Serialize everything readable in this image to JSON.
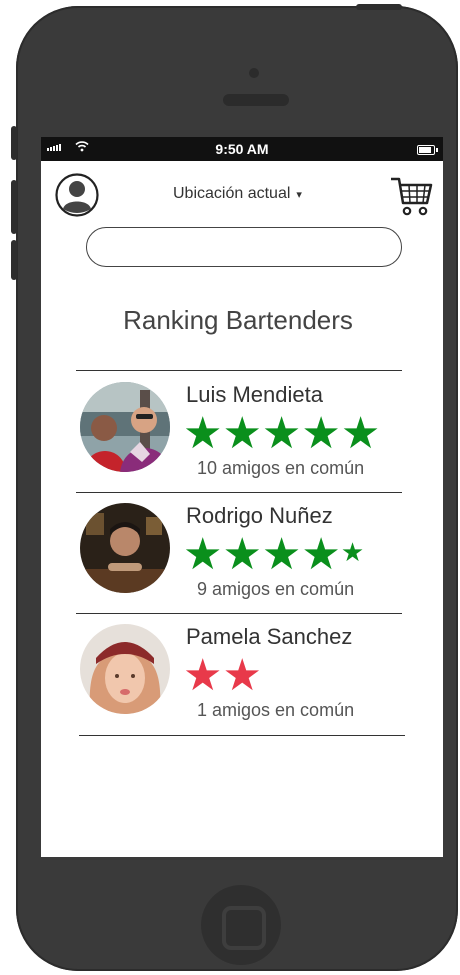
{
  "status_bar": {
    "time": "9:50 AM"
  },
  "header": {
    "location_label": "Ubicación actual",
    "caret": "▾"
  },
  "search": {
    "placeholder": "",
    "value": ""
  },
  "page": {
    "title": "Ranking Bartenders"
  },
  "bartenders": [
    {
      "name": "Luis Mendieta",
      "rating": 5,
      "star_color": "#0a8f1c",
      "friends": "10 amigos en común"
    },
    {
      "name": "Rodrigo Nuñez",
      "rating": 4.5,
      "star_color": "#0a8f1c",
      "friends": "9 amigos en común"
    },
    {
      "name": "Pamela Sanchez",
      "rating": 2,
      "star_color": "#e8394a",
      "friends": "1 amigos en común"
    }
  ],
  "icons": {
    "profile": "user-icon",
    "cart": "shopping-cart-icon",
    "wifi": "wifi-icon",
    "signal": "signal-icon",
    "battery": "battery-icon"
  }
}
